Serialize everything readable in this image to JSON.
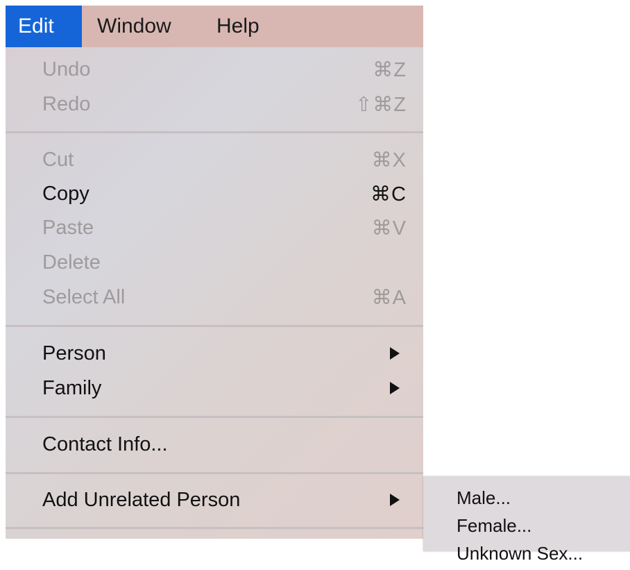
{
  "menubar": {
    "items": [
      {
        "label": "Edit"
      },
      {
        "label": "Window"
      },
      {
        "label": "Help"
      }
    ]
  },
  "edit_menu": {
    "undo": {
      "label": "Undo",
      "shortcut": "⌘Z",
      "enabled": false
    },
    "redo": {
      "label": "Redo",
      "shortcut": "⇧⌘Z",
      "enabled": false
    },
    "cut": {
      "label": "Cut",
      "shortcut": "⌘X",
      "enabled": false
    },
    "copy": {
      "label": "Copy",
      "shortcut": "⌘C",
      "enabled": true
    },
    "paste": {
      "label": "Paste",
      "shortcut": "⌘V",
      "enabled": false
    },
    "delete": {
      "label": "Delete",
      "enabled": false
    },
    "select_all": {
      "label": "Select All",
      "shortcut": "⌘A",
      "enabled": false
    },
    "person": {
      "label": "Person",
      "has_submenu": true
    },
    "family": {
      "label": "Family",
      "has_submenu": true
    },
    "contact_info": {
      "label": "Contact Info..."
    },
    "add_unrelated_person": {
      "label": "Add Unrelated Person",
      "has_submenu": true
    }
  },
  "submenu": {
    "items": [
      {
        "label": "Male..."
      },
      {
        "label": "Female..."
      },
      {
        "label": "Unknown Sex..."
      }
    ]
  },
  "colors": {
    "menubar_background": "#d8b7b3",
    "active_menu_highlight": "#1565d8",
    "disabled_text": "#9f9a9c",
    "enabled_text": "#111111"
  }
}
